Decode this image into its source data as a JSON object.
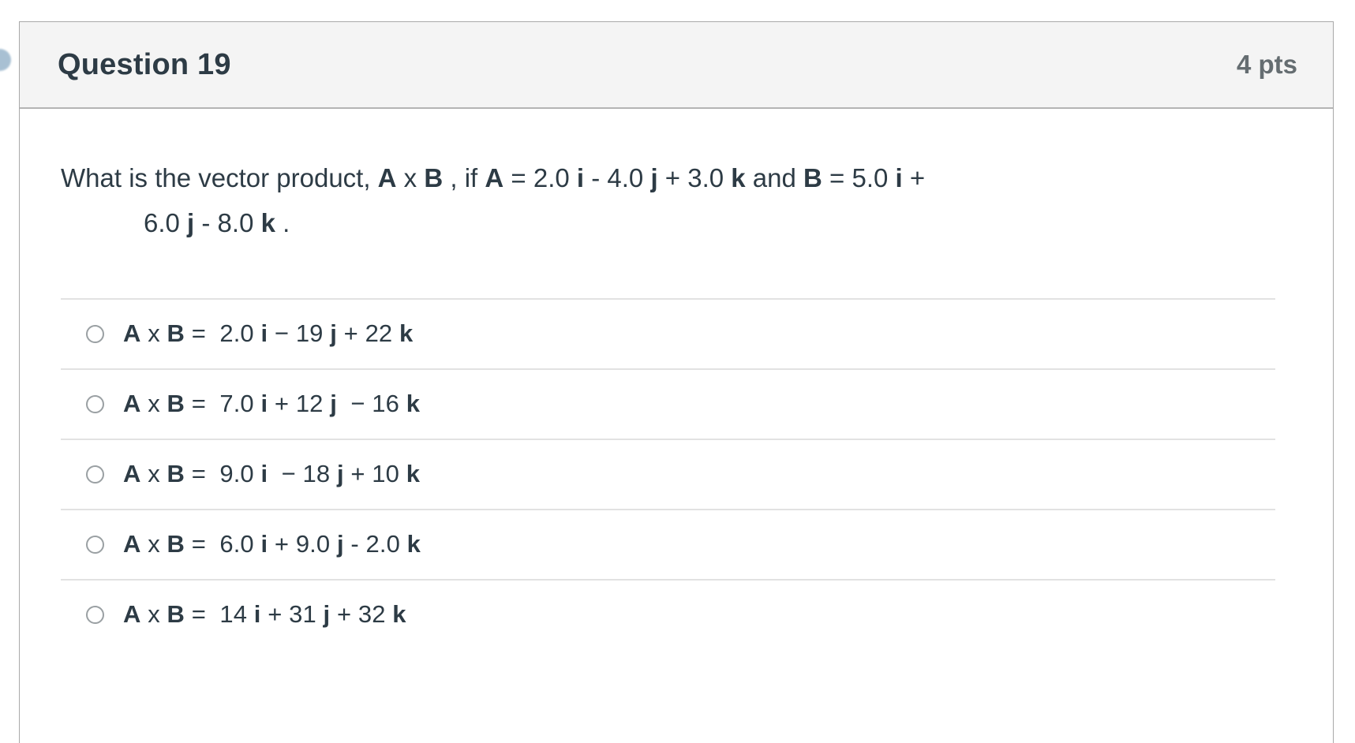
{
  "left_marker": {
    "icon": "chevron-bubble-icon",
    "color": "#9ab6cc"
  },
  "card": {
    "header": {
      "title": "Question 19",
      "points": "4 pts"
    },
    "question": {
      "line1_pre": "What is the vector product, ",
      "line1_vecA": "A",
      "line1_times": " x ",
      "line1_vecB": "B",
      "line1_mid": " , if  ",
      "line1_A": "A",
      "line1_A_val": " = 2.0 ",
      "line1_i": "i",
      "line1_i_sep": " - 4.0 ",
      "line1_j": "j",
      "line1_j_sep": "  + 3.0 ",
      "line1_k": "k",
      "line1_and": "   and  ",
      "line1_B": "B",
      "line1_B_val": " =  5.0 ",
      "line1_i2": "i",
      "line1_plus": " +",
      "line2_num1": "6.0 ",
      "line2_j": "j",
      "line2_sep": " - 8.0 ",
      "line2_k": "k",
      "line2_end": " ."
    },
    "answers": [
      {
        "id": "answer-option-1",
        "vecA": "A",
        "times": " x ",
        "vecB": "B",
        "equals": " =  ",
        "coef_i": "2.0 ",
        "i": "i",
        "sep_j": " − 19 ",
        "j": "j",
        "sep_k": " + 22 ",
        "k": "k",
        "selected": false
      },
      {
        "id": "answer-option-2",
        "vecA": "A",
        "times": " x ",
        "vecB": "B",
        "equals": " =  ",
        "coef_i": "7.0 ",
        "i": "i",
        "sep_j": " + 12 ",
        "j": "j",
        "sep_k": "  − 16 ",
        "k": "k",
        "selected": false
      },
      {
        "id": "answer-option-3",
        "vecA": "A",
        "times": " x ",
        "vecB": "B",
        "equals": " =  ",
        "coef_i": "9.0 ",
        "i": "i",
        "sep_j": "  − 18 ",
        "j": "j",
        "sep_k": " + 10 ",
        "k": "k",
        "selected": false
      },
      {
        "id": "answer-option-4",
        "vecA": "A",
        "times": " x ",
        "vecB": "B",
        "equals": " =  ",
        "coef_i": "6.0 ",
        "i": "i",
        "sep_j": " + 9.0 ",
        "j": "j",
        "sep_k": " - 2.0 ",
        "k": "k",
        "selected": false
      },
      {
        "id": "answer-option-5",
        "vecA": "A",
        "times": " x ",
        "vecB": "B",
        "equals": " =  ",
        "coef_i": "14 ",
        "i": "i",
        "sep_j": " + 31 ",
        "j": "j",
        "sep_k": " + 32 ",
        "k": "k",
        "selected": false
      }
    ]
  },
  "colors": {
    "text": "#2d3b45",
    "muted": "#656d71",
    "header_bg": "#f4f4f4",
    "border": "#a9a9a9",
    "divider": "#e2e2e2"
  }
}
